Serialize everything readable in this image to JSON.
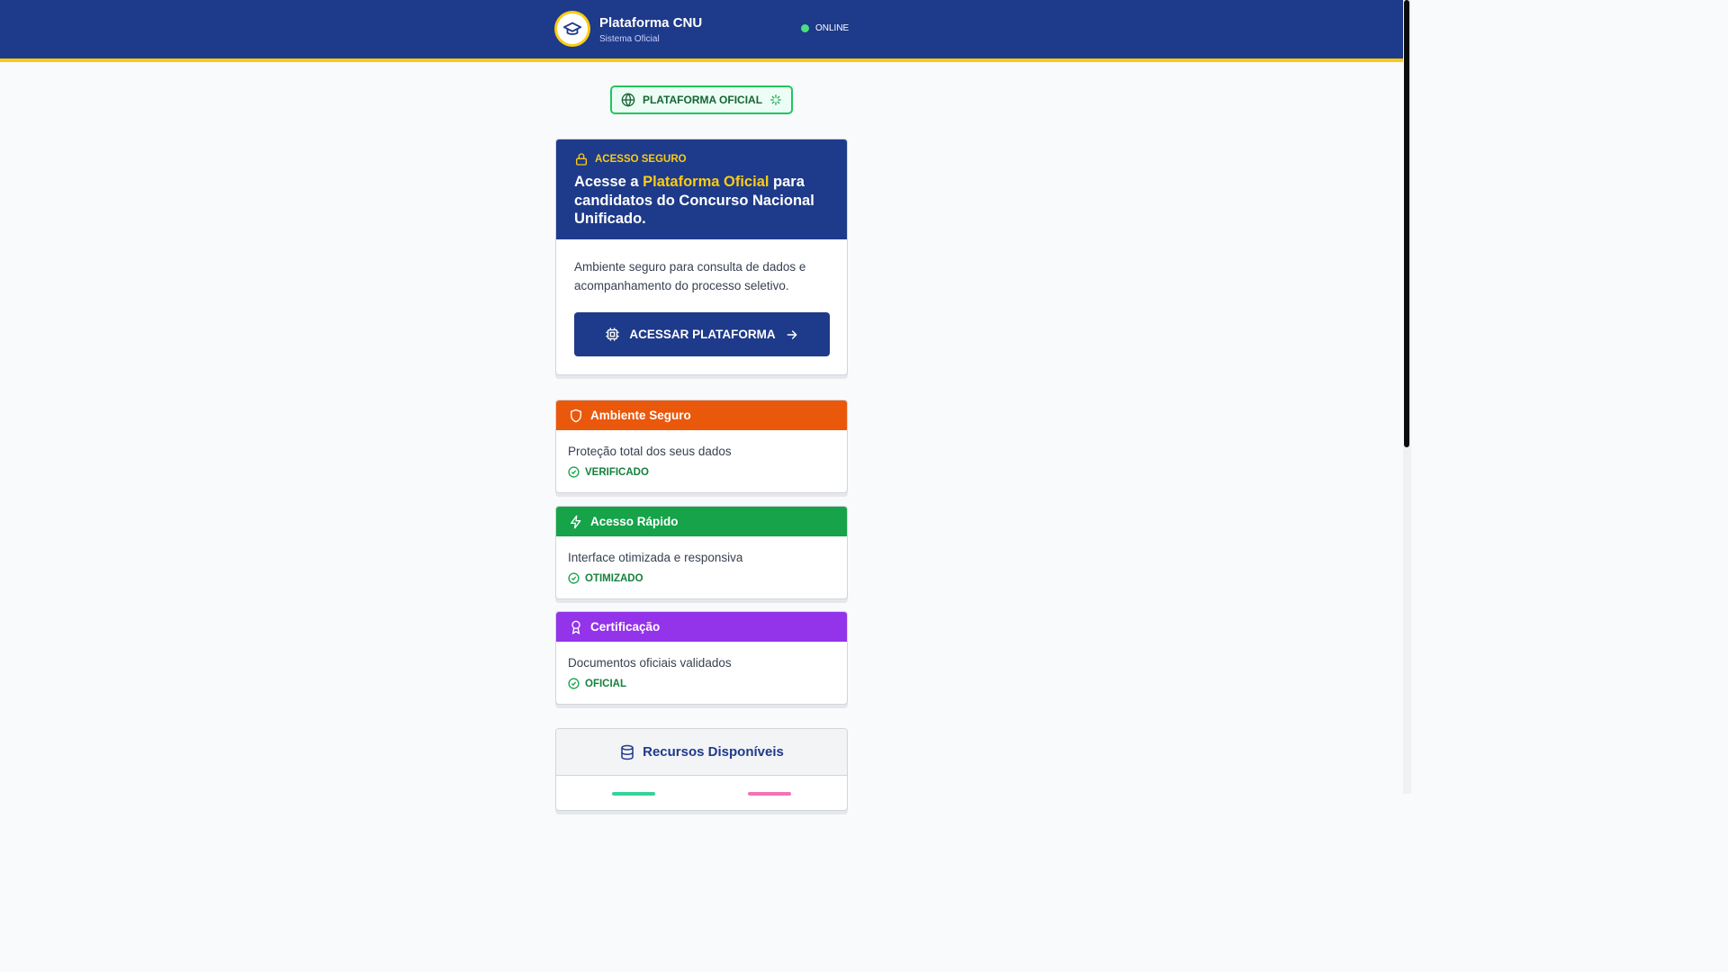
{
  "header": {
    "title": "Plataforma CNU",
    "subtitle": "Sistema Oficial",
    "status": "ONLINE"
  },
  "badge": {
    "label": "PLATAFORMA OFICIAL"
  },
  "hero": {
    "tag": "ACESSO SEGURO",
    "title_pre": "Acesse a ",
    "title_highlight": "Plataforma Oficial",
    "title_post": " para candidatos do Concurso Nacional Unificado.",
    "description": "Ambiente seguro para consulta de dados e acompanhamento do processo seletivo.",
    "cta_label": "ACESSAR PLATAFORMA"
  },
  "features": [
    {
      "title": "Ambiente Seguro",
      "description": "Proteção total dos seus dados",
      "status": "VERIFICADO",
      "color": "#ea580c",
      "icon": "shield-icon"
    },
    {
      "title": "Acesso Rápido",
      "description": "Interface otimizada e responsiva",
      "status": "OTIMIZADO",
      "color": "#16a34a",
      "icon": "lightning-icon"
    },
    {
      "title": "Certificação",
      "description": "Documentos oficiais validados",
      "status": "OFICIAL",
      "color": "#9333ea",
      "icon": "award-icon"
    }
  ],
  "resources": {
    "title": "Recursos Disponíveis"
  },
  "colors": {
    "primary": "#1e3a8a",
    "accent": "#facc15",
    "success": "#22c55e"
  }
}
